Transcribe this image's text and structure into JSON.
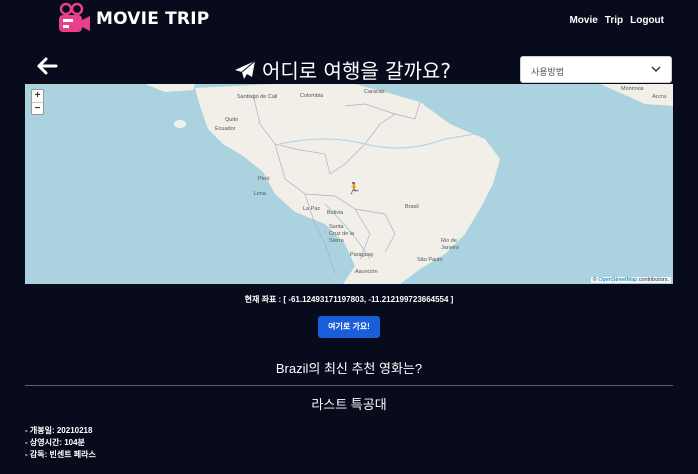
{
  "app": {
    "logo_text": "MOVIE TRIP"
  },
  "nav": {
    "items": [
      "Movie",
      "Trip",
      "Logout"
    ]
  },
  "header": {
    "title": "어디로 여행을 갈까요?"
  },
  "dropdown": {
    "selected": "사용방법"
  },
  "map": {
    "zoom_in": "+",
    "zoom_out": "−",
    "labels": {
      "caracas": "Caracas",
      "colombia": "Colombia",
      "santiago_cali": "Santiago de Cali",
      "quito": "Quito",
      "ecuador": "Ecuador",
      "peru": "Perú",
      "lima": "Lima",
      "la_paz": "La Paz",
      "bolivia": "Bolivia",
      "santa_cruz": "Santa Cruz de la Sierra",
      "brasil": "Brasil",
      "paraguay": "Paraguay",
      "asuncion": "Asunción",
      "rio": "Rio de Janeiro",
      "sao_paulo": "São Paulo",
      "monrovia": "Monrovia",
      "accra": "Accra"
    },
    "attribution_prefix": "© ",
    "attribution_link": "OpenStreetMap",
    "attribution_suffix": " contributors."
  },
  "coords": {
    "text": "현재 좌표 : [ -61.12493171197803, -11.212199723664554 ]"
  },
  "go_button": {
    "label": "여기로 가요!"
  },
  "recommendation": {
    "title": "Brazil의 최신 추천 영화는?",
    "movie_title": "라스트 특공대",
    "release": "- 개봉일: 20210218",
    "runtime": "- 상영시간: 104분",
    "director": "- 감독: 빈센트 페라스"
  },
  "colors": {
    "background": "#070b1c",
    "button": "#1a5fd9",
    "ocean": "#aad3df",
    "land": "#f2efe9",
    "marker": "#e01bd6"
  }
}
